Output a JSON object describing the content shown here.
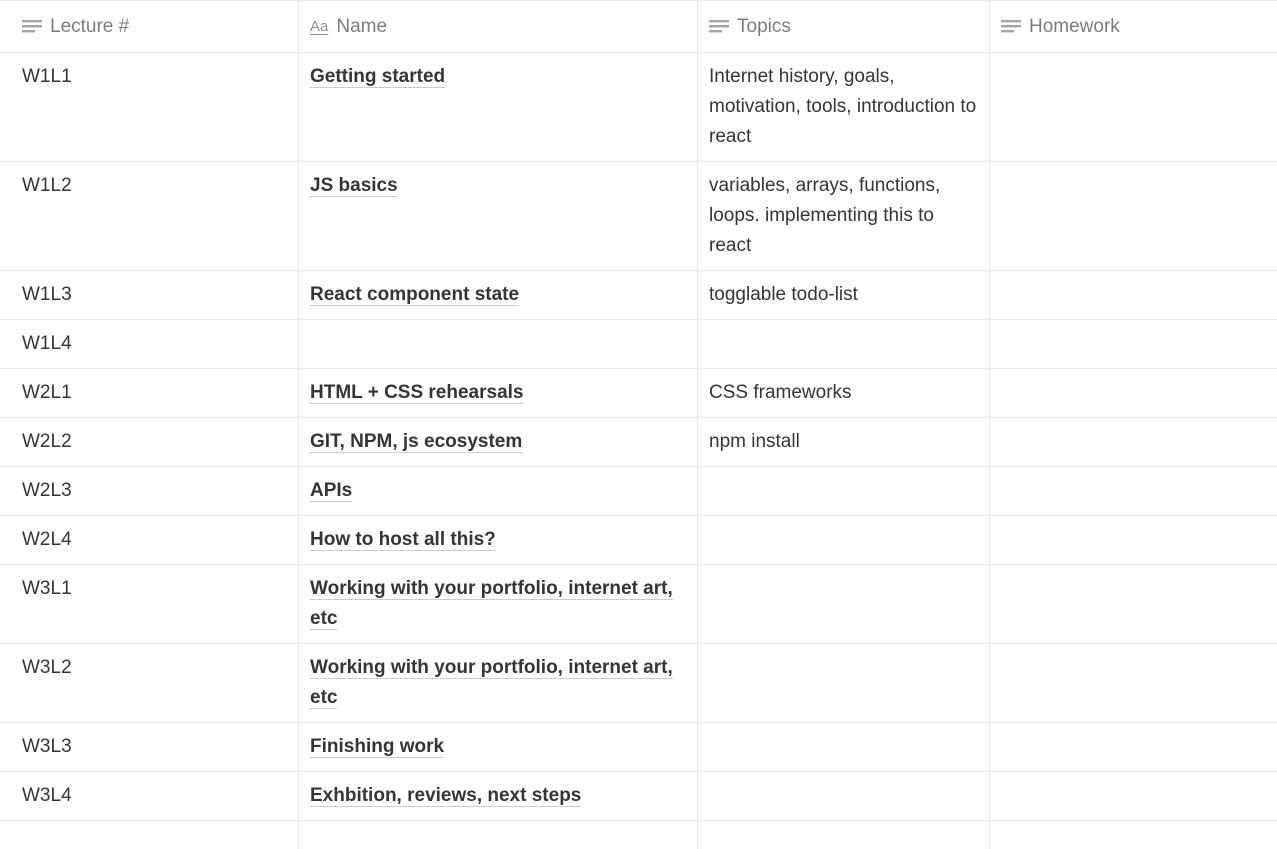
{
  "columns": [
    {
      "label": "Lecture #",
      "icon": "text-lines-icon"
    },
    {
      "label": "Name",
      "icon": "aa-title-icon"
    },
    {
      "label": "Topics",
      "icon": "text-lines-icon"
    },
    {
      "label": "Homework",
      "icon": "text-lines-icon"
    }
  ],
  "title_icon_text": "Aa",
  "rows": [
    {
      "lecture": "W1L1",
      "name": "Getting started",
      "topics": "Internet history, goals, motivation, tools, introduction to react",
      "homework": ""
    },
    {
      "lecture": "W1L2",
      "name": "JS basics",
      "topics": "variables, arrays, functions, loops. implementing this to react",
      "homework": ""
    },
    {
      "lecture": "W1L3",
      "name": "React component state",
      "topics": "togglable todo-list",
      "homework": ""
    },
    {
      "lecture": "W1L4",
      "name": "",
      "topics": "",
      "homework": ""
    },
    {
      "lecture": "W2L1",
      "name": "HTML + CSS rehearsals",
      "topics": "CSS frameworks",
      "homework": ""
    },
    {
      "lecture": "W2L2",
      "name": "GIT, NPM, js ecosystem",
      "topics": "npm install",
      "homework": ""
    },
    {
      "lecture": "W2L3",
      "name": "APIs",
      "topics": "",
      "homework": ""
    },
    {
      "lecture": "W2L4",
      "name": "How to host all this?",
      "topics": "",
      "homework": ""
    },
    {
      "lecture": "W3L1",
      "name": "Working with your portfolio, internet art, etc",
      "topics": "",
      "homework": ""
    },
    {
      "lecture": "W3L2",
      "name": "Working with your portfolio, internet art, etc",
      "topics": "",
      "homework": ""
    },
    {
      "lecture": "W3L3",
      "name": "Finishing work",
      "topics": "",
      "homework": ""
    },
    {
      "lecture": "W3L4",
      "name": "Exhbition, reviews, next steps",
      "topics": "",
      "homework": ""
    },
    {
      "lecture": "",
      "name": "",
      "topics": "",
      "homework": ""
    }
  ]
}
